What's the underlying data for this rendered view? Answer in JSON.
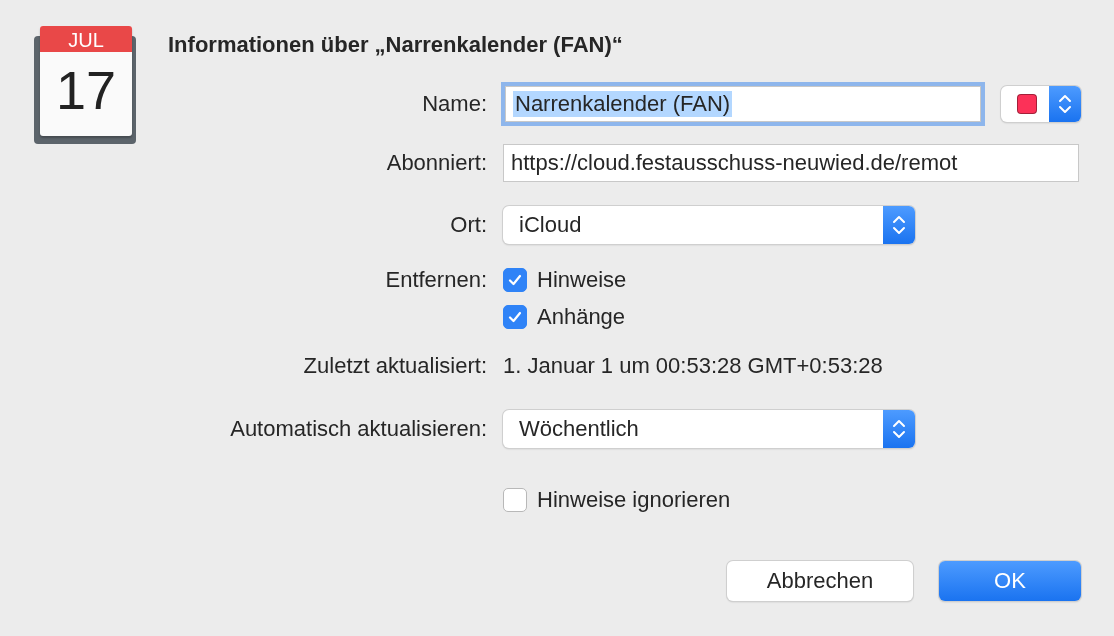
{
  "icon": {
    "month": "JUL",
    "day": "17"
  },
  "title": "Informationen über „Narrenkalender (FAN)“",
  "name": {
    "label": "Name:",
    "value": "Narrenkalender (FAN)",
    "focused": true
  },
  "color_well": {
    "color": "#fc3158"
  },
  "subscribed": {
    "label": "Abonniert:",
    "value": "https://cloud.festausschuss-neuwied.de/remot"
  },
  "location": {
    "label": "Ort:",
    "value": "iCloud"
  },
  "remove": {
    "label": "Entfernen:",
    "options": [
      {
        "label": "Hinweise",
        "checked": true
      },
      {
        "label": "Anhänge",
        "checked": true
      }
    ]
  },
  "last_updated": {
    "label": "Zuletzt aktualisiert:",
    "value": "1. Januar 1 um 00:53:28 GMT+0:53:28"
  },
  "auto_update": {
    "label": "Automatisch aktualisieren:",
    "value": "Wöchentlich"
  },
  "ignore_alerts": {
    "label": "Hinweise ignorieren",
    "checked": false
  },
  "buttons": [
    {
      "label": "Abbrechen",
      "default": false
    },
    {
      "label": "OK",
      "default": true
    }
  ]
}
